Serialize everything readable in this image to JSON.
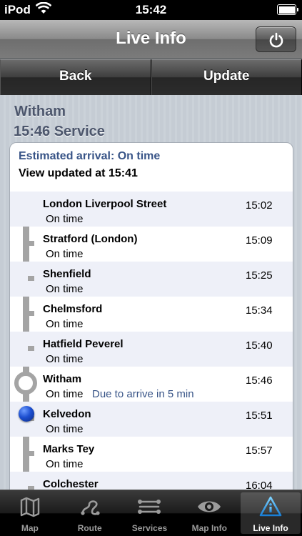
{
  "status_bar": {
    "carrier": "iPod",
    "time": "15:42",
    "battery_level": 1.0
  },
  "nav": {
    "title": "Live Info",
    "power_icon": "power-icon"
  },
  "toolbar": {
    "back_label": "Back",
    "update_label": "Update"
  },
  "service": {
    "station": "Witham",
    "service_label": "15:46 Service"
  },
  "live": {
    "estimate": "Estimated arrival: On time",
    "updated": "View updated at 15:41"
  },
  "stops": [
    {
      "name": "London Liverpool Street",
      "status": "On time",
      "time": "15:02",
      "note": ""
    },
    {
      "name": "Stratford (London)",
      "status": "On time",
      "time": "15:09",
      "note": ""
    },
    {
      "name": "Shenfield",
      "status": "On time",
      "time": "15:25",
      "note": ""
    },
    {
      "name": "Chelmsford",
      "status": "On time",
      "time": "15:34",
      "note": ""
    },
    {
      "name": "Hatfield Peverel",
      "status": "On time",
      "time": "15:40",
      "note": ""
    },
    {
      "name": "Witham",
      "status": "On time",
      "time": "15:46",
      "note": "Due to arrive in 5 min"
    },
    {
      "name": "Kelvedon",
      "status": "On time",
      "time": "15:51",
      "note": ""
    },
    {
      "name": "Marks Tey",
      "status": "On time",
      "time": "15:57",
      "note": ""
    },
    {
      "name": "Colchester",
      "status": "",
      "time": "16:04",
      "note": ""
    }
  ],
  "tabs": [
    {
      "label": "Map",
      "icon": "map-icon"
    },
    {
      "label": "Route",
      "icon": "route-icon"
    },
    {
      "label": "Services",
      "icon": "services-icon"
    },
    {
      "label": "Map Info",
      "icon": "eye-icon"
    },
    {
      "label": "Live Info",
      "icon": "info-icon"
    }
  ],
  "colors": {
    "accent_text": "#385487",
    "track": "#a4a4a4",
    "train_marker": "#1d4fd0"
  }
}
